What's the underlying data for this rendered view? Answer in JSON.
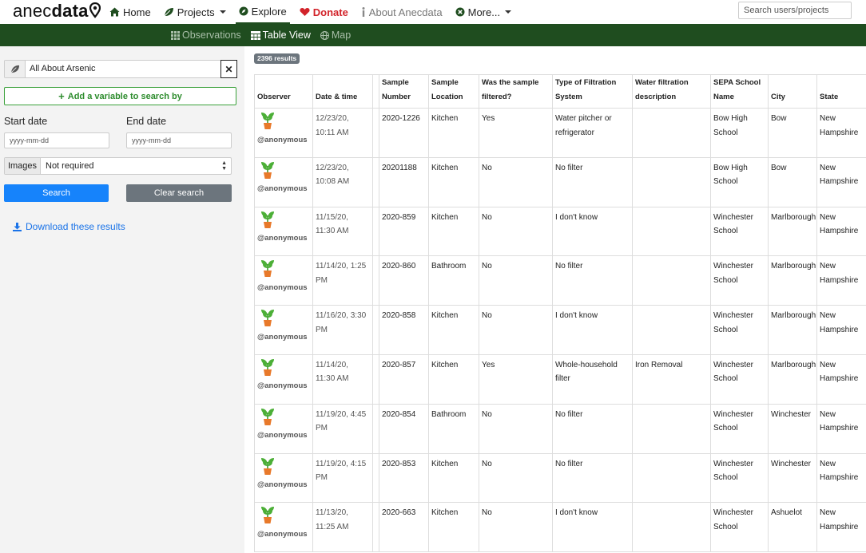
{
  "brand": {
    "part1": "anec",
    "part2": "data"
  },
  "nav": {
    "home": "Home",
    "projects": "Projects",
    "explore": "Explore",
    "donate": "Donate",
    "about": "About Anecdata",
    "more": "More..."
  },
  "search": {
    "placeholder": "Search users/projects"
  },
  "subnav": {
    "observations": "Observations",
    "table_view": "Table View",
    "map": "Map"
  },
  "sidebar": {
    "project": "All About Arsenic",
    "add_variable": "Add a variable to search by",
    "start_date_label": "Start date",
    "end_date_label": "End date",
    "date_placeholder": "yyyy-mm-dd",
    "images_label": "Images",
    "images_value": "Not required",
    "search_button": "Search",
    "clear_button": "Clear search",
    "download": "Download these results"
  },
  "results_count": "2396 results",
  "table": {
    "headers": [
      "Observer",
      "Date & time",
      "",
      "Sample Number",
      "Sample Location",
      "Was the sample filtered?",
      "Type of Filtration System",
      "Water filtration description",
      "SEPA School Name",
      "City",
      "State"
    ],
    "rows": [
      [
        "@anonymous",
        "12/23/20, 10:11 AM",
        "",
        "2020-1226",
        "Kitchen",
        "Yes",
        "Water pitcher or refrigerator",
        "",
        "Bow High School",
        "Bow",
        "New Hampshire"
      ],
      [
        "@anonymous",
        "12/23/20, 10:08 AM",
        "",
        "20201188",
        "Kitchen",
        "No",
        "No filter",
        "",
        "Bow High School",
        "Bow",
        "New Hampshire"
      ],
      [
        "@anonymous",
        "11/15/20, 11:30 AM",
        "",
        "2020-859",
        "Kitchen",
        "No",
        "I don't know",
        "",
        "Winchester School",
        "Marlborough",
        "New Hampshire"
      ],
      [
        "@anonymous",
        "11/14/20, 1:25 PM",
        "",
        "2020-860",
        "Bathroom",
        "No",
        "No filter",
        "",
        "Winchester School",
        "Marlborough",
        "New Hampshire"
      ],
      [
        "@anonymous",
        "11/16/20, 3:30 PM",
        "",
        "2020-858",
        "Kitchen",
        "No",
        "I don't know",
        "",
        "Winchester School",
        "Marlborough",
        "New Hampshire"
      ],
      [
        "@anonymous",
        "11/14/20, 11:30 AM",
        "",
        "2020-857",
        "Kitchen",
        "Yes",
        "Whole-household filter",
        "Iron Removal",
        "Winchester School",
        "Marlborough",
        "New Hampshire"
      ],
      [
        "@anonymous",
        "11/19/20, 4:45 PM",
        "",
        "2020-854",
        "Bathroom",
        "No",
        "No filter",
        "",
        "Winchester School",
        "Winchester",
        "New Hampshire"
      ],
      [
        "@anonymous",
        "11/19/20, 4:15 PM",
        "",
        "2020-853",
        "Kitchen",
        "No",
        "No filter",
        "",
        "Winchester School",
        "Winchester",
        "New Hampshire"
      ],
      [
        "@anonymous",
        "11/13/20, 11:25 AM",
        "",
        "2020-663",
        "Kitchen",
        "No",
        "I don't know",
        "",
        "Winchester School",
        "Ashuelot",
        "New Hampshire"
      ]
    ]
  },
  "colors": {
    "brand_green": "#1f4d1f",
    "donate_red": "#d2232a",
    "primary_blue": "#1683fb",
    "link_blue": "#1a73e8"
  }
}
